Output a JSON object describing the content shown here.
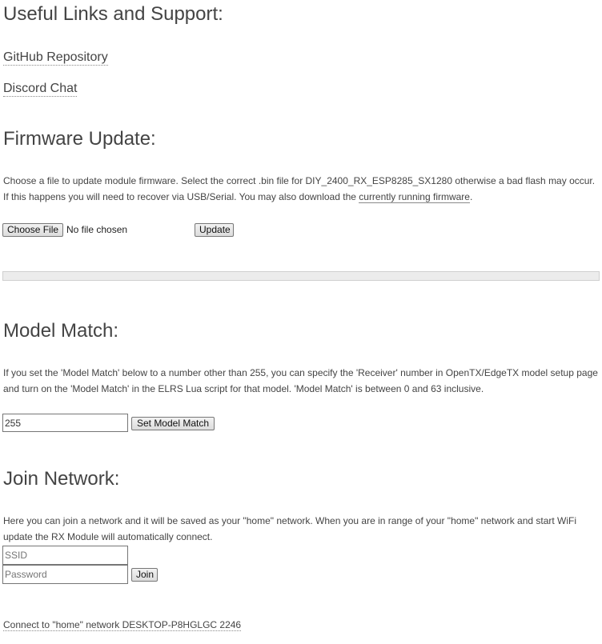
{
  "links_section": {
    "heading": "Useful Links and Support:",
    "github_label": "GitHub Repository",
    "discord_label": "Discord Chat"
  },
  "firmware": {
    "heading": "Firmware Update:",
    "description_before": "Choose a file to update module firmware. Select the correct .bin file for DIY_2400_RX_ESP8285_SX1280 otherwise a bad flash may occur. If this happens you will need to recover via USB/Serial. You may also download the ",
    "description_link": "currently running firmware",
    "description_after": ".",
    "choose_file_label": "Choose File",
    "no_file_text": "No file chosen",
    "update_label": "Update",
    "progress": 0
  },
  "model_match": {
    "heading": "Model Match:",
    "description": "If you set the 'Model Match' below to a number other than 255, you can specify the 'Receiver' number in OpenTX/EdgeTX model setup page and turn on the 'Model Match' in the ELRS Lua script for that model. 'Model Match' is between 0 and 63 inclusive.",
    "value": "255",
    "button_label": "Set Model Match"
  },
  "network": {
    "heading": "Join Network:",
    "description": "Here you can join a network and it will be saved as your \"home\" network. When you are in range of your \"home\" network and start WiFi update the RX Module will automatically connect.",
    "ssid_placeholder": "SSID",
    "password_placeholder": "Password",
    "join_label": "Join",
    "connect_link": "Connect to \"home\" network DESKTOP-P8HGLGC 2246"
  }
}
